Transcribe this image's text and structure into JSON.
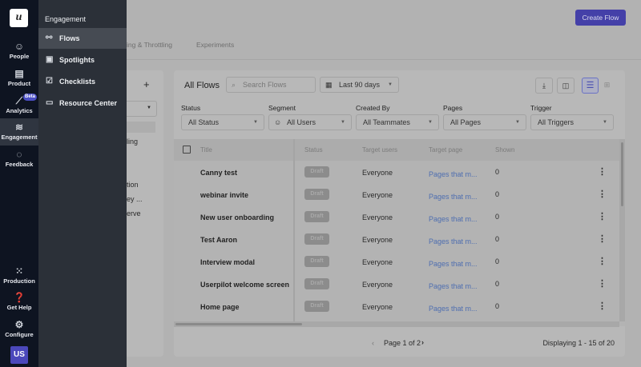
{
  "rail": {
    "logo": "u",
    "items": [
      {
        "label": "People",
        "icon": "people-icon"
      },
      {
        "label": "Product",
        "icon": "product-icon"
      },
      {
        "label": "Analytics",
        "icon": "analytics-icon",
        "badge": "Beta"
      },
      {
        "label": "Engagement",
        "icon": "layers-icon"
      },
      {
        "label": "Feedback",
        "icon": "chat-icon"
      }
    ],
    "bottom": [
      {
        "label": "Production",
        "icon": "grid-icon"
      },
      {
        "label": "Get Help",
        "icon": "help-icon"
      },
      {
        "label": "Configure",
        "icon": "gear-icon"
      }
    ],
    "avatar": "US"
  },
  "flyout": {
    "heading": "Engagement",
    "items": [
      {
        "label": "Flows"
      },
      {
        "label": "Spotlights"
      },
      {
        "label": "Checklists"
      },
      {
        "label": "Resource Center"
      }
    ]
  },
  "header": {
    "create_label": "Create Flow",
    "tabs": [
      "ing & Throttling",
      "Experiments"
    ]
  },
  "left_panel": {
    "add": "+",
    "partial": [
      "ling",
      "tion",
      "ey ...",
      "erve"
    ]
  },
  "main": {
    "title": "All Flows",
    "search_placeholder": "Search Flows",
    "date": "Last 90 days",
    "filters": [
      {
        "label": "Status",
        "value": "All Status"
      },
      {
        "label": "Segment",
        "value": "All Users"
      },
      {
        "label": "Created By",
        "value": "All Teammates"
      },
      {
        "label": "Pages",
        "value": "All Pages"
      },
      {
        "label": "Trigger",
        "value": "All Triggers"
      }
    ],
    "columns": [
      "Title",
      "Status",
      "Target users",
      "Target page",
      "Shown"
    ],
    "rows": [
      {
        "title": "Canny test",
        "status": "Draft",
        "users": "Everyone",
        "page": "Pages that m...",
        "shown": "0"
      },
      {
        "title": "webinar invite",
        "status": "Draft",
        "users": "Everyone",
        "page": "Pages that m...",
        "shown": "0"
      },
      {
        "title": "New user onboarding",
        "status": "Draft",
        "users": "Everyone",
        "page": "Pages that m...",
        "shown": "0"
      },
      {
        "title": "Test Aaron",
        "status": "Draft",
        "users": "Everyone",
        "page": "Pages that m...",
        "shown": "0"
      },
      {
        "title": "Interview modal",
        "status": "Draft",
        "users": "Everyone",
        "page": "Pages that m...",
        "shown": "0"
      },
      {
        "title": "Userpilot welcome screen",
        "status": "Draft",
        "users": "Everyone",
        "page": "Pages that m...",
        "shown": "0"
      },
      {
        "title": "Home page",
        "status": "Draft",
        "users": "Everyone",
        "page": "Pages that m...",
        "shown": "0"
      }
    ],
    "pagination": "Page 1 of 2",
    "displaying": "Displaying 1 - 15 of 20"
  }
}
